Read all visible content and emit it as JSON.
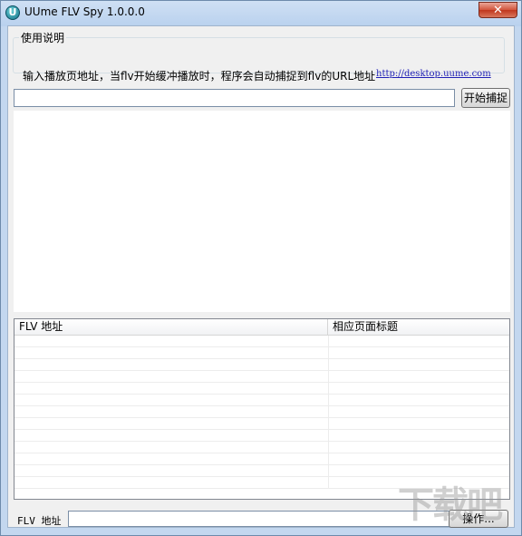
{
  "window": {
    "title": "UUme FLV Spy 1.0.0.0",
    "icon_letter": "U",
    "close_glyph": "✕"
  },
  "usage": {
    "legend": "使用说明",
    "text": "输入播放页地址，当flv开始缓冲播放时，程序会自动捕捉到flv的URL地址",
    "link": "http://desktop.uume.com"
  },
  "toolbar": {
    "url_value": "",
    "start_label": "开始捕捉"
  },
  "list": {
    "columns": [
      "FLV 地址",
      "相应页面标题"
    ],
    "rows": []
  },
  "bottom": {
    "label": "FLV 地址",
    "input_value": "",
    "action_label": "操作..."
  },
  "watermark": "下载吧"
}
